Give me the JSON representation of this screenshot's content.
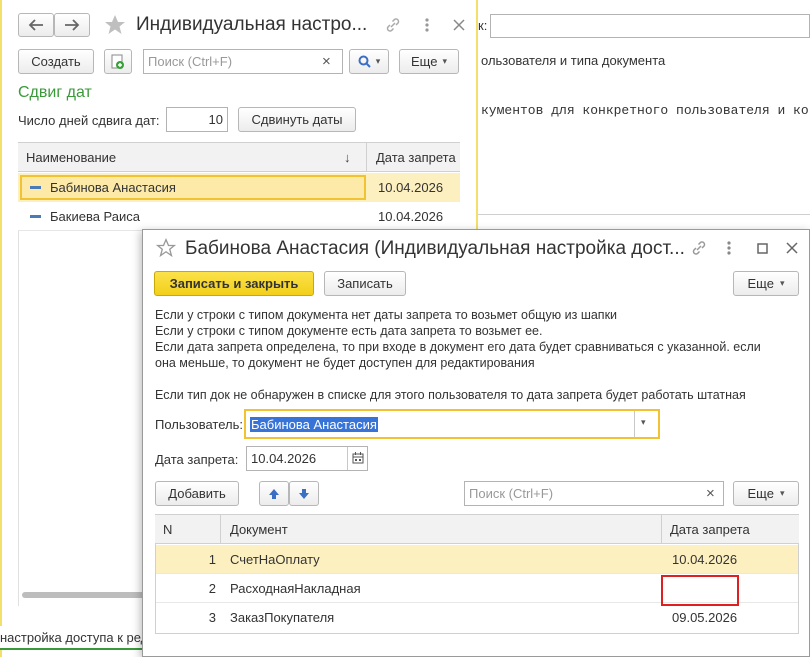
{
  "bg_window": {
    "field_label_tail": "к:",
    "line1": "ользователя и типа документа",
    "line2": "кументов для конкретного пользователя и ко"
  },
  "list_window": {
    "title": "Индивидуальная настро...",
    "create_label": "Создать",
    "search_placeholder": "Поиск (Ctrl+F)",
    "clear_glyph": "×",
    "search_glyph": "🔍",
    "more_label": "Еще",
    "dropdown_glyph": "▾",
    "section_title": "Сдвиг дат",
    "shift_label": "Число дней сдвига дат:",
    "shift_value": "10",
    "shift_button": "Сдвинуть даты",
    "col_name": "Наименование",
    "sort_glyph": "↓",
    "col_date": "Дата запрета",
    "rows": [
      {
        "name": "Бабинова Анастасия",
        "date": "10.04.2026"
      },
      {
        "name": "Бакиева Раиса",
        "date": "10.04.2026"
      }
    ],
    "tab_label": "настройка доступа к ред"
  },
  "form_window": {
    "title": "Бабинова Анастасия (Индивидуальная настройка дост...",
    "save_close": "Записать и закрыть",
    "save": "Записать",
    "more_label": "Еще",
    "notes": [
      "Если у строки с типом документа нет даты запрета то возьмет общую из шапки",
      "Если у строки с типом документе есть дата запрета то возьмет ее.",
      "Если дата запрета определена, то при входе в документ его дата будет сравниваться с указанной. если",
      "она меньше, то документ не будет доступен для редактирования",
      "Если тип док не обнаружен в списке для этого пользователя  то дата запрета будет работать штатная"
    ],
    "user_label": "Пользователь:",
    "user_value": "Бабинова Анастасия",
    "date_label": "Дата запрета:",
    "date_value": "10.04.2026",
    "add_label": "Добавить",
    "search_placeholder": "Поиск (Ctrl+F)",
    "clear_glyph": "×",
    "col_n": "N",
    "col_doc": "Документ",
    "col_date": "Дата запрета",
    "rows": [
      {
        "n": "1",
        "doc": "СчетНаОплату",
        "date": "10.04.2026"
      },
      {
        "n": "2",
        "doc": "РасходнаяНакладная",
        "date": ""
      },
      {
        "n": "3",
        "doc": "ЗаказПокупателя",
        "date": "09.05.2026"
      }
    ]
  },
  "colors": {
    "accent_yellow": "#f3cf1a",
    "selection_row": "#fdf0c0",
    "section_green": "#3a9a3a",
    "error_red": "#e02020"
  }
}
